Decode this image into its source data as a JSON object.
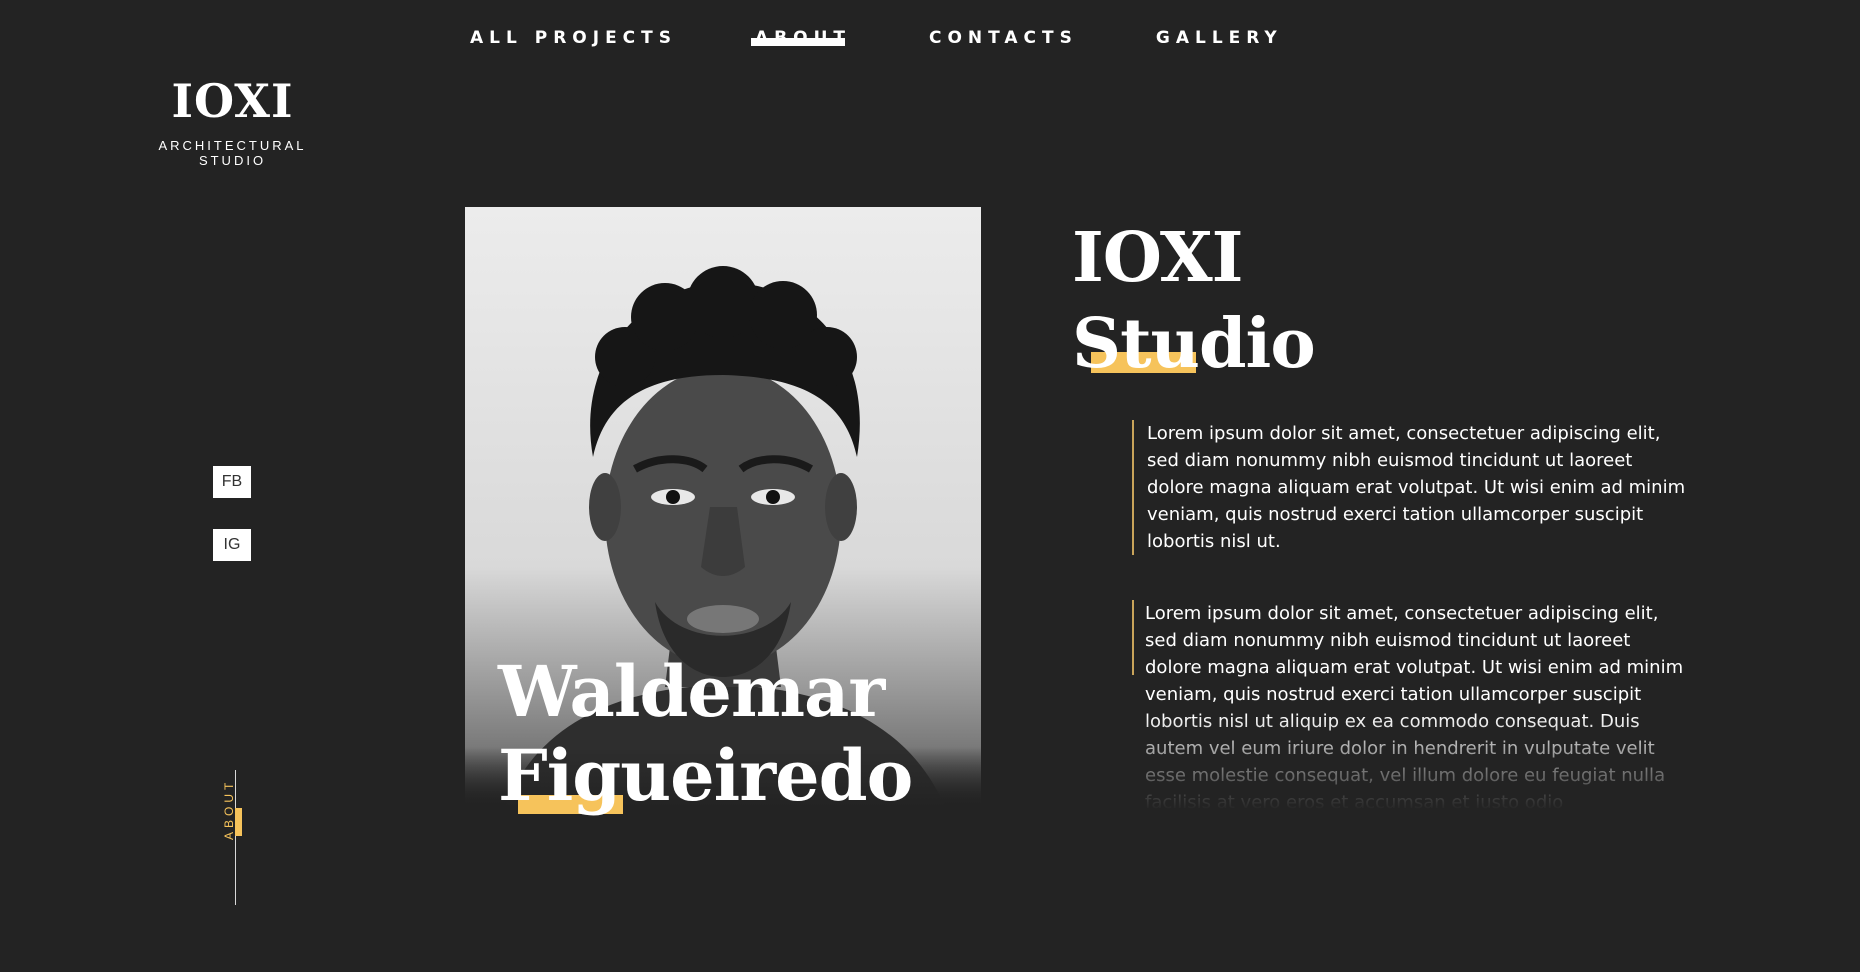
{
  "nav": {
    "items": [
      {
        "label": "ALL PROJECTS"
      },
      {
        "label": "ABOUT"
      },
      {
        "label": "CONTACTS"
      },
      {
        "label": "GALLERY"
      }
    ]
  },
  "logo": {
    "mark": "IOXI",
    "subtitle": "ARCHITECTURAL STUDIO"
  },
  "social": {
    "fb": "FB",
    "ig": "IG"
  },
  "side": {
    "label": "ABOUT"
  },
  "profile": {
    "first_name": "Waldemar",
    "last_name": "Figueiredo"
  },
  "heading": {
    "line1": "IOXI",
    "line2": "Studio"
  },
  "paragraphs": [
    "Lorem ipsum dolor sit amet, consectetuer adipiscing elit, sed diam nonummy nibh euismod tincidunt ut laoreet dolore magna aliquam erat volutpat. Ut wisi enim ad minim veniam, quis nostrud exerci tation ullamcorper suscipit lobortis nisl ut.",
    "Lorem ipsum dolor sit amet, consectetuer adipiscing elit, sed diam nonummy nibh euismod tincidunt ut laoreet dolore magna aliquam erat volutpat. Ut wisi enim ad minim veniam, quis nostrud exerci tation ullamcorper suscipit lobortis nisl ut aliquip ex ea commodo consequat. Duis autem vel eum iriure dolor in hendrerit in vulputate velit esse molestie consequat, vel illum dolore eu feugiat nulla facilisis at vero eros et accumsan et iusto odio"
  ],
  "colors": {
    "background": "#232323",
    "accent": "#f6c35b",
    "text": "#ffffff"
  },
  "icons": {
    "portrait": "person-photo"
  }
}
